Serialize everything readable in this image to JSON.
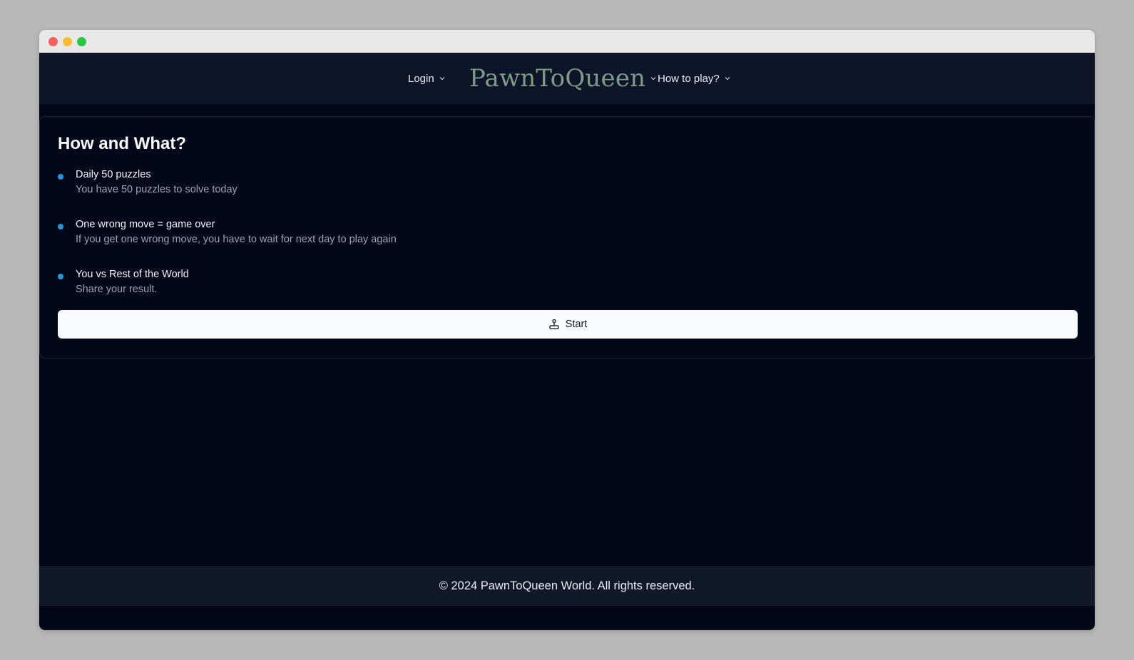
{
  "navbar": {
    "login_label": "Login",
    "brand": "PawnToQueen",
    "howto_label": "How to play?"
  },
  "card": {
    "title": "How and What?",
    "features": [
      {
        "title": "Daily 50 puzzles",
        "description": "You have 50 puzzles to solve today"
      },
      {
        "title": "One wrong move = game over",
        "description": "If you get one wrong move, you have to wait for next day to play again"
      },
      {
        "title": "You vs Rest of the World",
        "description": "Share your result."
      }
    ],
    "start_label": "Start",
    "start_icon": "joystick-icon",
    "bullet_color": "#1e9be0"
  },
  "footer": {
    "text": "© 2024 PawnToQueen World. All rights reserved."
  },
  "colors": {
    "background": "#020817",
    "navbar": "#0e1529",
    "brand": "#7a9c88",
    "footer": "#111827"
  }
}
